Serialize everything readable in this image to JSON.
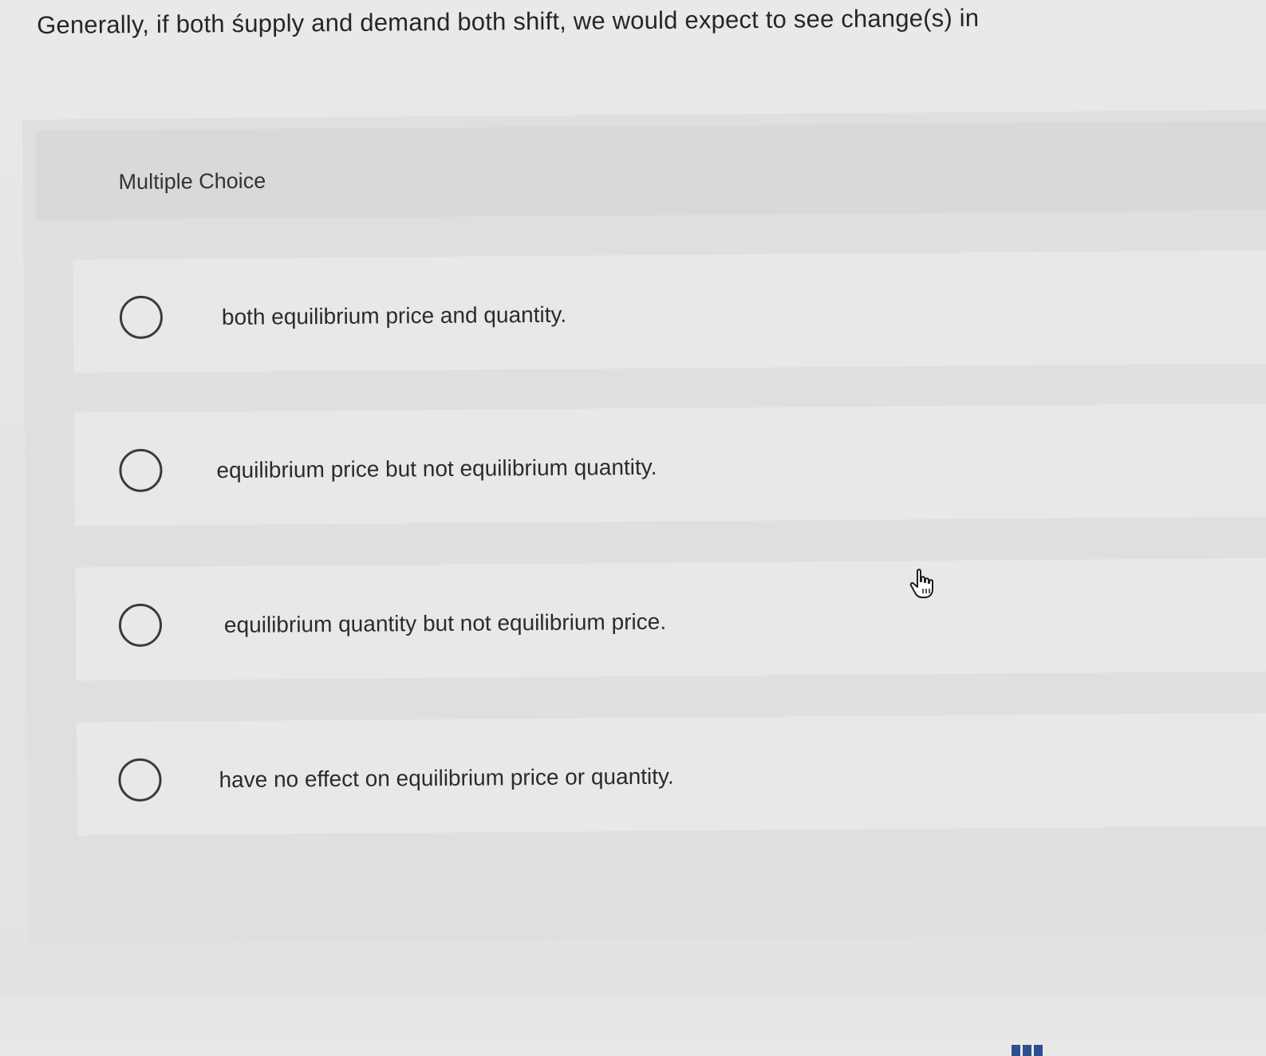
{
  "question": {
    "text": "Generally, if both śupply and demand both shift, we would expect to see change(s) in"
  },
  "section": {
    "label": "Multiple Choice"
  },
  "options": [
    {
      "label": "both equilibrium price and quantity."
    },
    {
      "label": "equilibrium price but not equilibrium quantity."
    },
    {
      "label": "equilibrium quantity but not equilibrium price."
    },
    {
      "label": "have no effect on equilibrium price or quantity."
    }
  ],
  "cursor": {
    "icon": "hand-pointer-icon"
  },
  "colors": {
    "background": "#e4e5e3",
    "panel": "#dfe0de",
    "option_row": "#e8e9e7",
    "text": "#2a2a2a",
    "taskbar_icon": "#2e4f8f"
  }
}
